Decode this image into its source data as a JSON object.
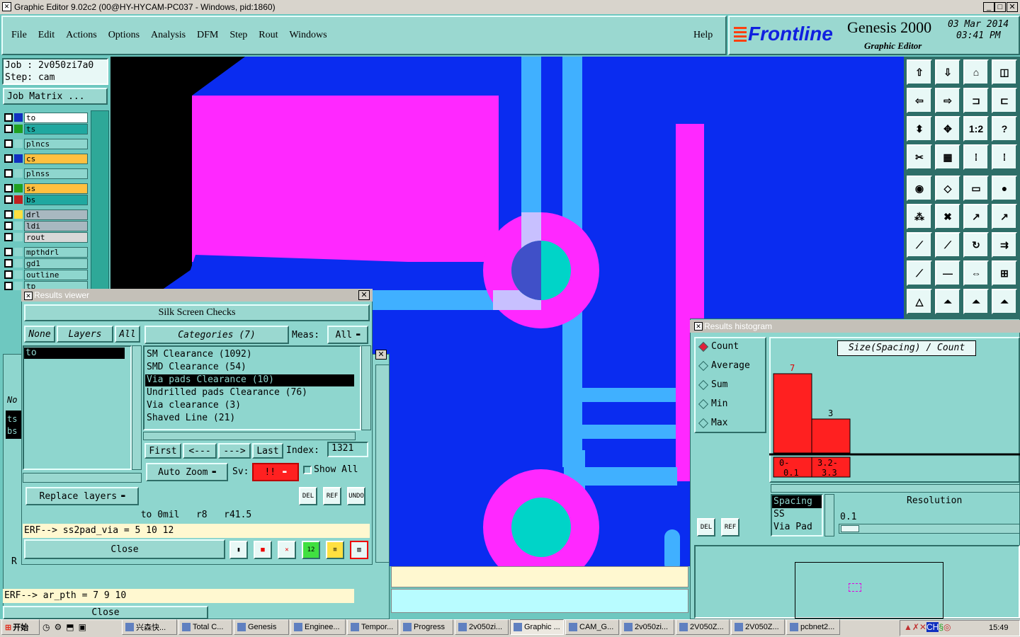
{
  "window": {
    "title": "Graphic Editor 9.02c2 (00@HY-HYCAM-PC037 - Windows, pid:1860)"
  },
  "menu": [
    "File",
    "Edit",
    "Actions",
    "Options",
    "Analysis",
    "DFM",
    "Step",
    "Rout",
    "Windows"
  ],
  "help": "Help",
  "brand": {
    "logo": "Frontline",
    "product": "Genesis 2000",
    "subtitle": "Graphic Editor",
    "date": "03 Mar 2014",
    "time": "03:41 PM"
  },
  "job": {
    "job_label": "Job : 2v050zi7a0",
    "step_label": "Step: cam",
    "matrix_button": "Job Matrix ..."
  },
  "layers": [
    {
      "name": "to",
      "color": "#ffffff"
    },
    {
      "name": "ts",
      "color": "#20a8a0"
    },
    {
      "name": "plncs",
      "color": "#8ed6ce"
    },
    {
      "name": "cs",
      "color": "#ffc040"
    },
    {
      "name": "plnss",
      "color": "#8ed6ce"
    },
    {
      "name": "ss",
      "color": "#ffc040"
    },
    {
      "name": "bs",
      "color": "#20a8a0"
    },
    {
      "name": "drl",
      "color": "#a8b8c0"
    },
    {
      "name": "ldi",
      "color": "#a8b8c0"
    },
    {
      "name": "rout",
      "color": "#d8d8d8"
    },
    {
      "name": "mpthdrl",
      "color": "#8ed6ce"
    },
    {
      "name": "gd1",
      "color": "#8ed6ce"
    },
    {
      "name": "outline",
      "color": "#8ed6ce"
    },
    {
      "name": "tp",
      "color": "#8ed6ce"
    }
  ],
  "results_viewer": {
    "title": "Results viewer",
    "heading": "Silk Screen Checks",
    "none_btn": "None",
    "layers_btn": "Layers",
    "all_btn": "All",
    "layer_items": [
      "to"
    ],
    "categories_label": "Categories (7)",
    "meas_label": "Meas:",
    "meas_value": "All",
    "categories": [
      {
        "text": "SM Clearance (1092)",
        "selected": false
      },
      {
        "text": "SMD Clearance (54)",
        "selected": false
      },
      {
        "text": "Via pads Clearance (10)",
        "selected": true
      },
      {
        "text": "Undrilled pads Clearance (76)",
        "selected": false
      },
      {
        "text": "Via clearance (3)",
        "selected": false
      },
      {
        "text": "Shaved Line (21)",
        "selected": false
      }
    ],
    "nav": {
      "first": "First",
      "prev": "<---",
      "next": "--->",
      "last": "Last",
      "index_label": "Index:",
      "index_value": "1321"
    },
    "auto_zoom": "Auto Zoom",
    "sv_label": "Sv:",
    "sv_value": "!!",
    "show_all": "Show All",
    "replace_layers": "Replace layers",
    "del": "DEL",
    "ref": "REF",
    "undo": "UNDO",
    "status": "to 0mil   r8   r41.5",
    "erf": "ERF--> ss2pad_via = 5 10 12",
    "close": "Close"
  },
  "back_window": {
    "erf": "ERF--> ar_pth = 7 9 10",
    "close": "Close",
    "items": [
      "No",
      "ts",
      "bs",
      "R"
    ]
  },
  "histogram": {
    "title": "Results histogram",
    "modes": [
      {
        "label": "Count",
        "selected": true
      },
      {
        "label": "Average",
        "selected": false
      },
      {
        "label": "Sum",
        "selected": false
      },
      {
        "label": "Min",
        "selected": false
      },
      {
        "label": "Max",
        "selected": false
      }
    ],
    "chart_title": "Size(Spacing) / Count",
    "del": "DEL",
    "ref": "REF",
    "info_lines": [
      "Spacing",
      "SS",
      "Via Pad"
    ],
    "resolution_label": "Resolution",
    "resolution_value": "0.1"
  },
  "chart_data": {
    "type": "bar",
    "categories": [
      "0-\n0.1",
      "3.2-\n3.3"
    ],
    "category_lines": [
      [
        "0-",
        "0.1"
      ],
      [
        "3.2-",
        "3.3"
      ]
    ],
    "values": [
      7,
      3
    ],
    "ylim": [
      0,
      8
    ],
    "title": "Size(Spacing) / Count",
    "xlabel": "",
    "ylabel": "",
    "color": "#ff2020"
  },
  "taskbar": {
    "start": "开始",
    "items": [
      "兴森快...",
      "Total C...",
      "Genesis",
      "Enginee...",
      "Tempor...",
      "Progress",
      "2v050zi...",
      "Graphic ...",
      "CAM_G...",
      "2v050zi...",
      "2V050Z...",
      "2V050Z...",
      "pcbnet2..."
    ],
    "clock": "15:49"
  },
  "colors": {
    "bg": "#6ec8c0",
    "board_blue": "#0a2cf0",
    "magenta": "#ff28ff",
    "cyan": "#00d4c8",
    "trace": "#40b0ff",
    "chart_bar": "#ff2020"
  }
}
